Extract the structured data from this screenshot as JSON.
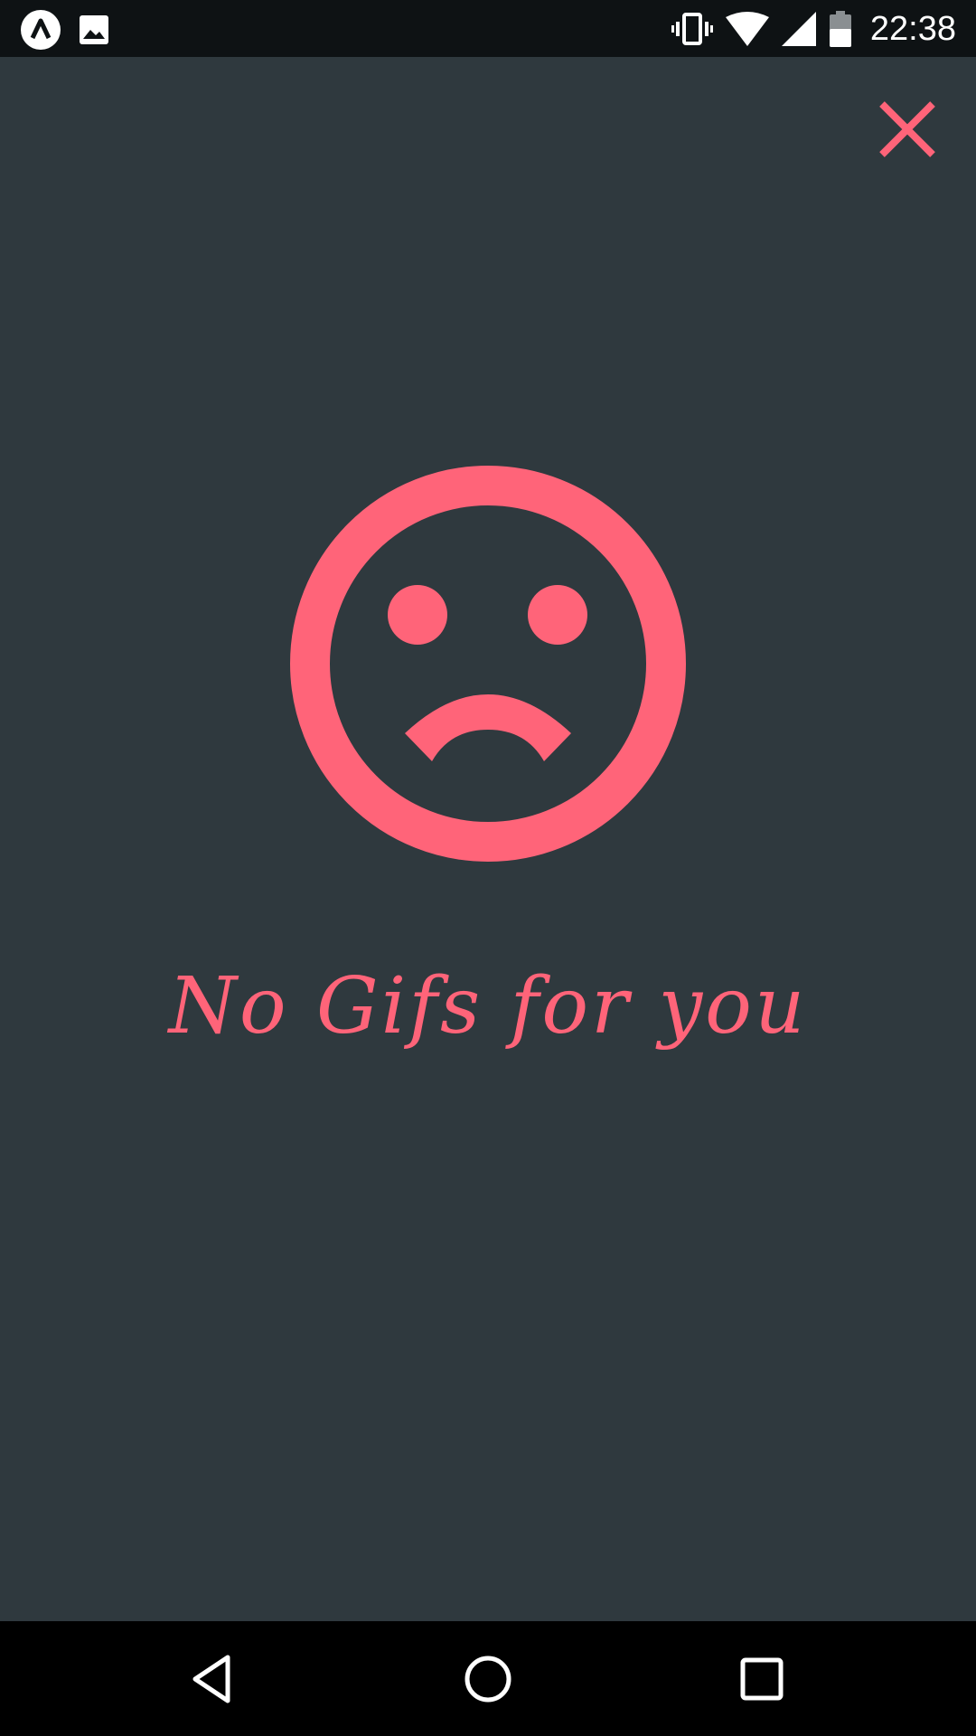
{
  "status_bar": {
    "time": "22:38",
    "icons": [
      "app-logo-icon",
      "image-icon",
      "vibrate-icon",
      "wifi-icon",
      "signal-icon",
      "battery-icon"
    ]
  },
  "main": {
    "close_icon": "close-icon",
    "illustration": "sad-face-icon",
    "message": "No Gifs for you"
  },
  "nav_bar": {
    "icons": [
      "back-icon",
      "home-icon",
      "recents-icon"
    ]
  },
  "colors": {
    "accent": "#ff6479",
    "background": "#2f393e",
    "status_bar": "#0e1214",
    "nav_bar": "#000000"
  }
}
